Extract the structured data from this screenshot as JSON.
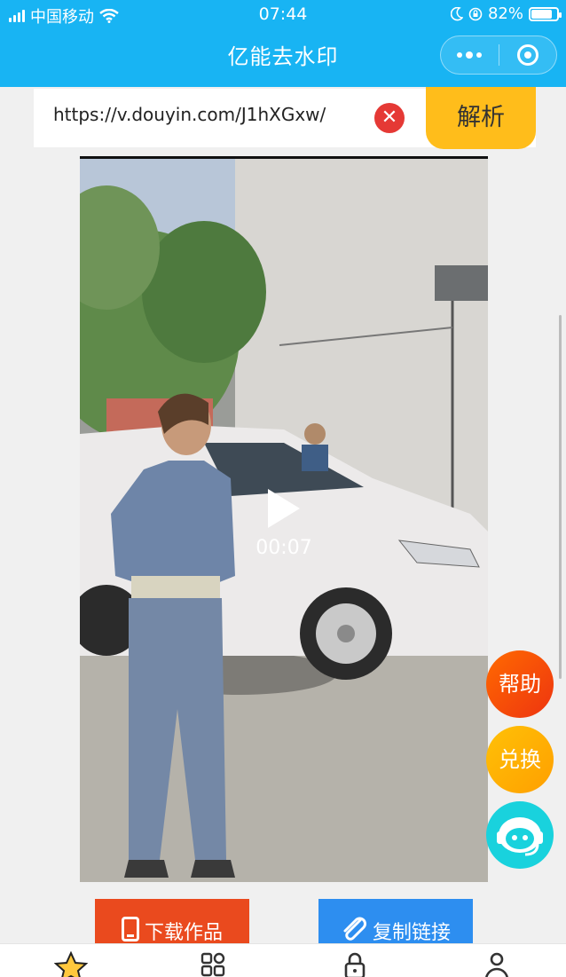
{
  "status_bar": {
    "carrier": "中国移动",
    "time": "07:44",
    "battery": "82%",
    "battery_level": 0.82
  },
  "nav": {
    "title": "亿能去水印",
    "more_icon": "more-dots-icon",
    "close_icon": "target-circle-icon"
  },
  "url_bar": {
    "value": "https://v.douyin.com/J1hXGxw/",
    "clear_symbol": "✕",
    "parse_label": "解析"
  },
  "video": {
    "duration": "00:07",
    "play_icon": "play-icon"
  },
  "floating_buttons": {
    "help": "帮助",
    "exchange": "兑换",
    "service_icon": "customer-service-icon"
  },
  "actions": {
    "download_label": "下载作品",
    "copy_label": "复制链接"
  },
  "tabbar": {
    "items": [
      {
        "icon": "star-icon"
      },
      {
        "icon": "grid-icon"
      },
      {
        "icon": "lock-icon"
      },
      {
        "icon": "person-icon"
      }
    ]
  },
  "colors": {
    "nav_bg": "#18b4f3",
    "parse_bg": "#ffbd1b",
    "download_bg": "#ea4a1e",
    "copy_bg": "#2d8ef0",
    "clear_bg": "#e53935"
  }
}
